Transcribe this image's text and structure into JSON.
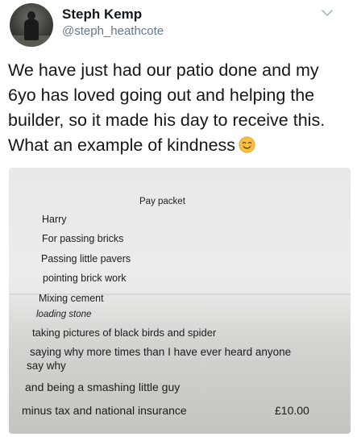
{
  "tweet": {
    "display_name": "Steph Kemp",
    "handle": "@steph_heathcote",
    "text": "We have just had our patio done and my 6yo has loved going out and helping the builder, so it made his day to receive this. What an example of kindness",
    "emoji": "smiling-face-emoji"
  },
  "note": {
    "title": "Pay packet",
    "lines": [
      "Harry",
      "For passing bricks",
      "Passing little pavers",
      "pointing brick work",
      "Mixing cement",
      "loading stone",
      "taking pictures of black birds and spider",
      "saying why more times than I have ever heard anyone",
      "say why",
      "and being a smashing little guy",
      "minus tax and national insurance"
    ],
    "amount": "£10.00"
  },
  "colors": {
    "text": "#14171a",
    "handle": "#657786",
    "chevron": "#aab8c2",
    "emoji_face": "#f5c242"
  }
}
